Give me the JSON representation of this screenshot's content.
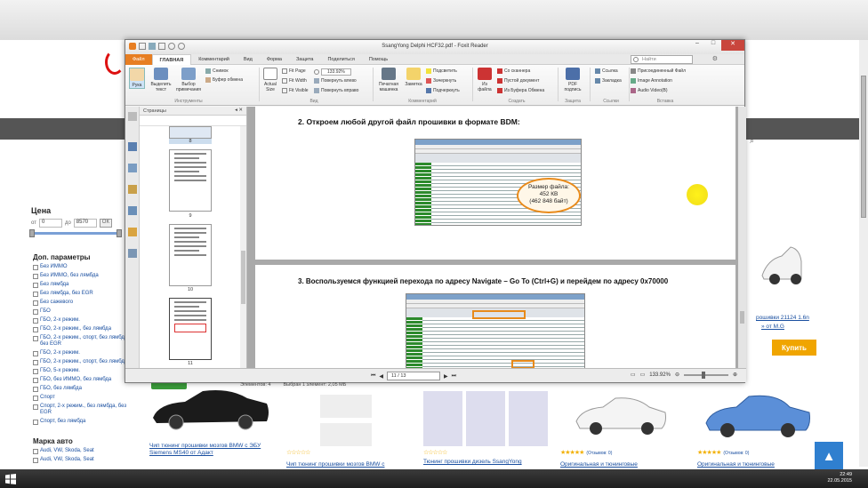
{
  "colors": {
    "accent": "#e77e22",
    "site_link": "#1a4fa0",
    "buy": "#f0a500",
    "up_button": "#2f7fcf"
  },
  "foxit": {
    "title": "SsangYong Delphi HCF32.pdf - Foxit Reader",
    "menu": [
      "Файл",
      "ГЛАВНАЯ",
      "Комментарий",
      "Вид",
      "Форма",
      "Защита",
      "Поделиться",
      "Помощь"
    ],
    "search_placeholder": "Найти",
    "ribbon": {
      "tools": {
        "hand": "Рука",
        "select_text": "Выделить текст",
        "select_annot": "Выбор примечания",
        "snapshot": "Снимок",
        "clipboard": "Буфер обмена",
        "group": "Инструменты"
      },
      "view": {
        "actual_size": "Actual Size",
        "fit_page": "Fit Page",
        "fit_width": "Fit Width",
        "fit_visible": "Fit Visible",
        "zoom": "133.92%",
        "rotate_left": "Повернуть влево",
        "rotate_right": "Повернуть вправо",
        "group": "Вид"
      },
      "comment": {
        "typewriter": "Печатная машинка",
        "note": "Заметка",
        "highlight": "Подсветить",
        "strikeout": "Зачеркнуть",
        "underline": "Подчеркнуть",
        "group": "Комментарий"
      },
      "create": {
        "from_file": "Из файла",
        "from_scanner": "Со сканнера",
        "blank": "Пустой документ",
        "from_clipboard": "Из Буфера Обмена",
        "group": "Создать"
      },
      "protect": {
        "pdf_sign": "PDF подпись",
        "group": "Защита"
      },
      "links": {
        "link": "Ссылка",
        "bookmark": "Закладка",
        "group": "Ссылки"
      },
      "insert": {
        "file_attach": "Присоединенный Файл",
        "image_annot": "Image Annotation",
        "audio_video": "Audio  Video(B)",
        "group": "Вставка"
      }
    },
    "panel": {
      "title": "Страницы",
      "thumbs": [
        "8",
        "9",
        "10",
        "11"
      ]
    },
    "doc": {
      "step2": "2.   Откроем любой другой файл прошивки в формате BDM:",
      "bubble": [
        "Размер файла:",
        "452 КВ",
        "(462 848 байт)"
      ],
      "step3": "3.   Воспользуемся функцией перехода по адресу Navigate – Go To (Ctrl+G) и перейдем по адресу 0x70000"
    },
    "status": {
      "page": "11 / 13",
      "zoom": "133.92%"
    }
  },
  "explorer": {
    "items": "Элементов: 4",
    "selected": "Выбран 1 элемент: 2,05 МБ"
  },
  "site": {
    "price": {
      "title": "Цена",
      "from": "от",
      "from_val": "0",
      "to": "до",
      "to_val": "8570",
      "ok": "ОК"
    },
    "params_title": "Доп. параметры",
    "params": [
      "Без ИММО",
      "Без ИММО, без лямбда",
      "Без лямбда",
      "Без лямбда, без EGR",
      "Без сажевого",
      "ГБО",
      "ГБО, 2-х режим.",
      "ГБО, 2-х режим., без лямбда",
      "ГБО, 2-х режим., спорт, без лямбда, без EGR",
      "ГБО, 2-х режим.",
      "ГБО, 2-х режим., спорт, без лямбда",
      "ГБО, 5-х режим.",
      "ГБО, без ИММО, без лямбда",
      "ГБО, без лямбда",
      "Спорт",
      "Спорт, 2-х режим., без лямбда, без EGR",
      "Спорт, без лямбда"
    ],
    "brand_title": "Марка авто",
    "brands": [
      "Audi, VW, Skoda, Seat",
      "Audi, VW, Skoda, Seat"
    ],
    "products": [
      {
        "title": "Чип тюнинг прошивки мозгов BMW с ЭБУ Siemens MS40 от Адакт"
      },
      {
        "title": "Чип тюнинг прошивки мозгов BMW с"
      },
      {
        "title": "Тюнинг прошивки дизель SsangYong"
      },
      {
        "title": "Оригинальная и тюнинговые"
      },
      {
        "title": "Оригинальная и тюнинговые"
      }
    ],
    "side_title": "рошивки 21124 1.6n",
    "side_sub": "» от М.G",
    "reviews": "(Отзывов: 0)",
    "buy": "Купить",
    "up": "▲"
  },
  "taskbar": {
    "time": "22:49",
    "date": "22.05.2015"
  }
}
